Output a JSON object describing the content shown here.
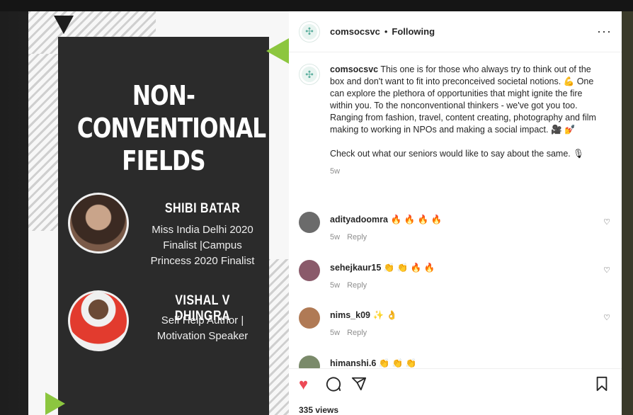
{
  "poster": {
    "title_line1": "NON-",
    "title_line2": "CONVENTIONAL",
    "title_line3": "FIELDS",
    "people": [
      {
        "name": "SHIBI BATAR",
        "desc_line1": "Miss India Delhi 2020",
        "desc_line2": "Finalist |Campus",
        "desc_line3": "Princess 2020 Finalist"
      },
      {
        "name": "VISHAL V DHINGRA",
        "desc_line1": "Self Help Author |",
        "desc_line2": "Motivation Speaker",
        "desc_line3": ""
      }
    ]
  },
  "header": {
    "username": "comsocsvc",
    "separator": "•",
    "follow_label": "Following",
    "more_label": "···"
  },
  "caption": {
    "username": "comsocsvc",
    "text": "This one is for those who always try to think out of the box and don't want to fit into preconceived societal notions. 💪 One can explore the plethora of opportunities that might ignite the fire within you. To the nonconventional thinkers - we've got you too. Ranging from fashion, travel, content creating, photography and film making to working in NPOs and making a social impact. 🎥 💅",
    "text2": "Check out what our seniors would like to say about the same. 🎙",
    "time": "5w"
  },
  "comments": [
    {
      "username": "adityadoomra",
      "text": "🔥 🔥 🔥 🔥",
      "time": "5w",
      "reply": "Reply",
      "avatar_color": "#6b6b6b"
    },
    {
      "username": "sehejkaur15",
      "text": "👏 👏 🔥 🔥",
      "time": "5w",
      "reply": "Reply",
      "avatar_color": "#8a5a6a"
    },
    {
      "username": "nims_k09",
      "text": "✨ 👌",
      "time": "5w",
      "reply": "Reply",
      "avatar_color": "#b07a55"
    },
    {
      "username": "himanshi.6",
      "text": "👏 👏 👏",
      "time": "",
      "reply": "",
      "avatar_color": "#7a8a6a"
    }
  ],
  "actions": {
    "like_icon": "heart-icon",
    "comment_icon": "comment-icon",
    "share_icon": "share-icon",
    "save_icon": "bookmark-icon",
    "like_color": "#ed4956"
  },
  "views_label": "335 views"
}
